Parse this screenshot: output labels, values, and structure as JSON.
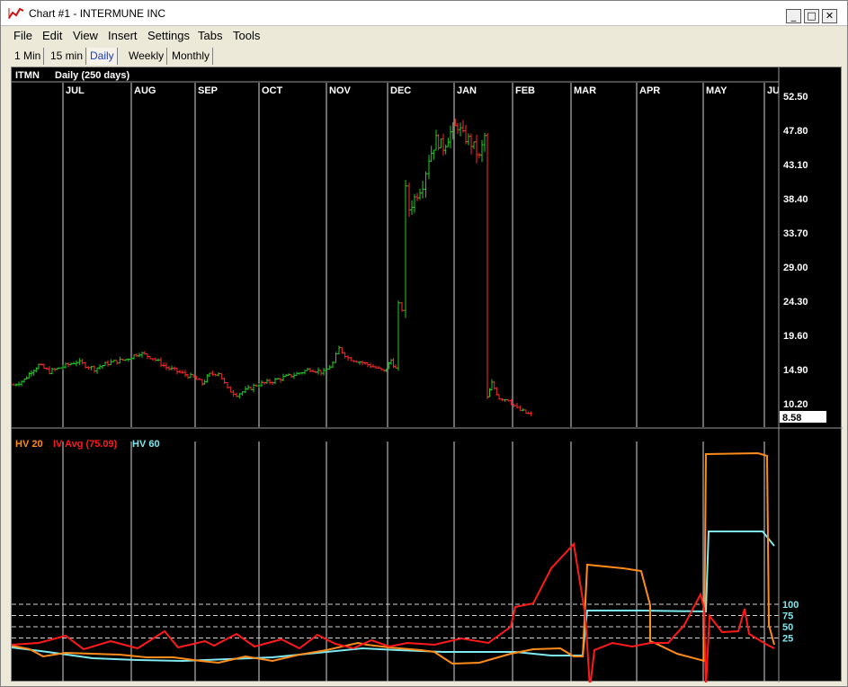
{
  "window": {
    "title": "Chart #1 - INTERMUNE INC",
    "buttons": {
      "minimize": "_",
      "maximize": "□",
      "close": "✕"
    }
  },
  "menu": [
    "File",
    "Edit",
    "View",
    "Insert",
    "Settings",
    "Tabs",
    "Tools"
  ],
  "timeframe_tabs": [
    {
      "label": "1 Min",
      "active": false
    },
    {
      "label": "15 min",
      "active": false
    },
    {
      "label": "Daily",
      "active": true
    },
    {
      "label": "Weekly",
      "active": false
    },
    {
      "label": "Monthly",
      "active": false
    }
  ],
  "colors": {
    "up_bar": "#22cc22",
    "down_bar": "#ff2a2a",
    "hv20": "#ff8c1a",
    "iv_avg": "#ff1a1a",
    "hv60": "#7fe9f0",
    "grid": "#d8d8d8",
    "background": "#000000"
  },
  "chart_data": [
    {
      "type": "ohlc",
      "symbol": "ITMN",
      "period_label": "Daily (250 days)",
      "months": [
        "JUL",
        "AUG",
        "SEP",
        "OCT",
        "NOV",
        "DEC",
        "JAN",
        "FEB",
        "MAR",
        "APR",
        "MAY",
        "JU"
      ],
      "y_ticks": [
        "52.50",
        "47.80",
        "43.10",
        "38.40",
        "33.70",
        "29.00",
        "24.30",
        "19.60",
        "14.90",
        "10.20"
      ],
      "ylim": [
        8.0,
        54.0
      ],
      "last_price": "8.58",
      "approx_close_path": [
        [
          0,
          12.8
        ],
        [
          12,
          13.5
        ],
        [
          20,
          14.7
        ],
        [
          28,
          15.5
        ],
        [
          40,
          14.6
        ],
        [
          55,
          15.3
        ],
        [
          70,
          16.0
        ],
        [
          90,
          15.0
        ],
        [
          105,
          15.8
        ],
        [
          125,
          16.3
        ],
        [
          140,
          17.2
        ],
        [
          155,
          16.5
        ],
        [
          170,
          15.2
        ],
        [
          185,
          14.5
        ],
        [
          200,
          13.8
        ],
        [
          210,
          13.0
        ],
        [
          218,
          14.2
        ],
        [
          228,
          14.5
        ],
        [
          238,
          12.2
        ],
        [
          248,
          11.5
        ],
        [
          258,
          12.0
        ],
        [
          270,
          12.8
        ],
        [
          285,
          13.2
        ],
        [
          300,
          13.8
        ],
        [
          315,
          14.3
        ],
        [
          330,
          15.0
        ],
        [
          345,
          14.5
        ],
        [
          355,
          15.8
        ],
        [
          362,
          17.8
        ],
        [
          372,
          16.5
        ],
        [
          385,
          16.0
        ],
        [
          400,
          15.3
        ],
        [
          412,
          14.6
        ],
        [
          420,
          16.2
        ],
        [
          425,
          15.0
        ],
        [
          428,
          23.8
        ],
        [
          432,
          23.2
        ],
        [
          436,
          39.5
        ],
        [
          440,
          37.0
        ],
        [
          446,
          38.5
        ],
        [
          455,
          40.5
        ],
        [
          462,
          44.0
        ],
        [
          470,
          46.5
        ],
        [
          478,
          45.5
        ],
        [
          486,
          47.5
        ],
        [
          494,
          48.5
        ],
        [
          500,
          47.0
        ],
        [
          506,
          46.5
        ],
        [
          512,
          45.5
        ],
        [
          518,
          44.0
        ],
        [
          524,
          47.0
        ],
        [
          527,
          11.0
        ],
        [
          532,
          13.0
        ],
        [
          540,
          11.0
        ],
        [
          550,
          10.8
        ],
        [
          560,
          9.5
        ],
        [
          570,
          8.9
        ],
        [
          578,
          8.58
        ]
      ]
    },
    {
      "type": "line",
      "series": [
        {
          "name": "HV 20"
        },
        {
          "name": "IV Avg (75.09)"
        },
        {
          "name": "HV 60"
        }
      ],
      "y_ticks": [
        "100",
        "75",
        "50",
        "25"
      ],
      "ylim": [
        0,
        460
      ]
    }
  ]
}
